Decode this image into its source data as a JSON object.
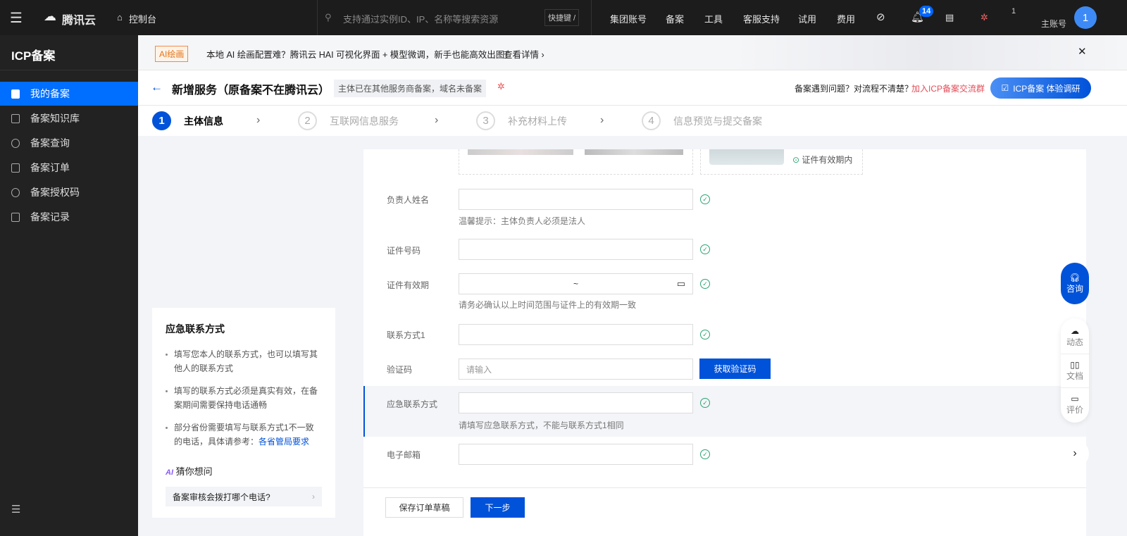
{
  "topbar": {
    "brand": "腾讯云",
    "console": "控制台",
    "search_placeholder": "支持通过实例ID、IP、名称等搜索资源",
    "shortcut": "快捷键 /",
    "nav": [
      "集团账号",
      "备案",
      "工具",
      "客服支持",
      "试用",
      "费用"
    ],
    "notification_count": "14",
    "account_count": "1",
    "account_label": "主账号",
    "avatar": "1"
  },
  "sidebar": {
    "title": "ICP备案",
    "items": [
      {
        "label": "我的备案"
      },
      {
        "label": "备案知识库"
      },
      {
        "label": "备案查询"
      },
      {
        "label": "备案订单"
      },
      {
        "label": "备案授权码"
      },
      {
        "label": "备案记录"
      }
    ]
  },
  "banner": {
    "tag": "AI绘画",
    "text": "本地 AI 绘画配置难？腾讯云 HAI 可视化界面 + 模型微调，新手也能高效出图！",
    "link": "查看详情"
  },
  "header": {
    "title": "新增服务（原备案不在腾讯云）",
    "tag": "主体已在其他服务商备案，域名未备案",
    "question": "备案遇到问题？对流程不清楚？",
    "join_link": "加入ICP备案交流群",
    "survey_button": "ICP备案  体验调研"
  },
  "steps": [
    {
      "num": "1",
      "label": "主体信息"
    },
    {
      "num": "2",
      "label": "互联网信息服务"
    },
    {
      "num": "3",
      "label": "补充材料上传"
    },
    {
      "num": "4",
      "label": "信息预览与提交备案"
    }
  ],
  "help": {
    "title": "应急联系方式",
    "items": [
      "填写您本人的联系方式，也可以填写其他人的联系方式",
      "填写的联系方式必须是真实有效，在备案期间需要保持电话通畅",
      "部分省份需要填写与联系方式1不一致的电话，具体请参考："
    ],
    "link": "各省管局要求",
    "ai_label": "猜你想问",
    "question": "备案审核会拨打哪个电话?"
  },
  "form": {
    "cert_valid": "证件有效期内",
    "fields": [
      {
        "label": "负责人姓名",
        "tip": "温馨提示：主体负责人必须是法人"
      },
      {
        "label": "证件号码"
      },
      {
        "label": "证件有效期",
        "value": "~",
        "tip": "请务必确认以上时间范围与证件上的有效期一致"
      },
      {
        "label": "联系方式1"
      },
      {
        "label": "验证码",
        "placeholder": "请输入",
        "button": "获取验证码"
      },
      {
        "label": "应急联系方式",
        "tip": "请填写应急联系方式，不能与联系方式1相同"
      },
      {
        "label": "电子邮箱"
      }
    ],
    "save_button": "保存订单草稿",
    "next_button": "下一步"
  },
  "float": {
    "consult": "咨询",
    "items": [
      "动态",
      "文档",
      "评价"
    ]
  }
}
